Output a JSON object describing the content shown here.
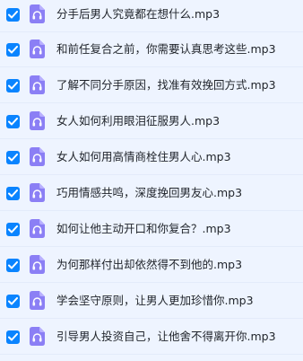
{
  "colors": {
    "row_background": "#eef4ff",
    "checkbox": "#0a84ff",
    "audio_icon": "#8b7ff5",
    "text": "#1f2329"
  },
  "icons": {
    "checkbox": "checkmark-icon",
    "file": "audio-file-icon"
  },
  "files": [
    {
      "name": "分手后男人究竟都在想什么.mp3",
      "selected": true
    },
    {
      "name": "和前任复合之前，你需要认真思考这些.mp3",
      "selected": true
    },
    {
      "name": "了解不同分手原因，找准有效挽回方式.mp3",
      "selected": true
    },
    {
      "name": "女人如何利用眼泪征服男人.mp3",
      "selected": true
    },
    {
      "name": "女人如何用高情商栓住男人心.mp3",
      "selected": true
    },
    {
      "name": "巧用情感共鸣，深度挽回男友心.mp3",
      "selected": true
    },
    {
      "name": "如何让他主动开口和你复合？.mp3",
      "selected": true
    },
    {
      "name": "为何那样付出却依然得不到他的.mp3",
      "selected": true
    },
    {
      "name": "学会坚守原则，让男人更加珍惜你.mp3",
      "selected": true
    },
    {
      "name": "引导男人投资自己，让他舍不得离开你.mp3",
      "selected": true
    }
  ]
}
